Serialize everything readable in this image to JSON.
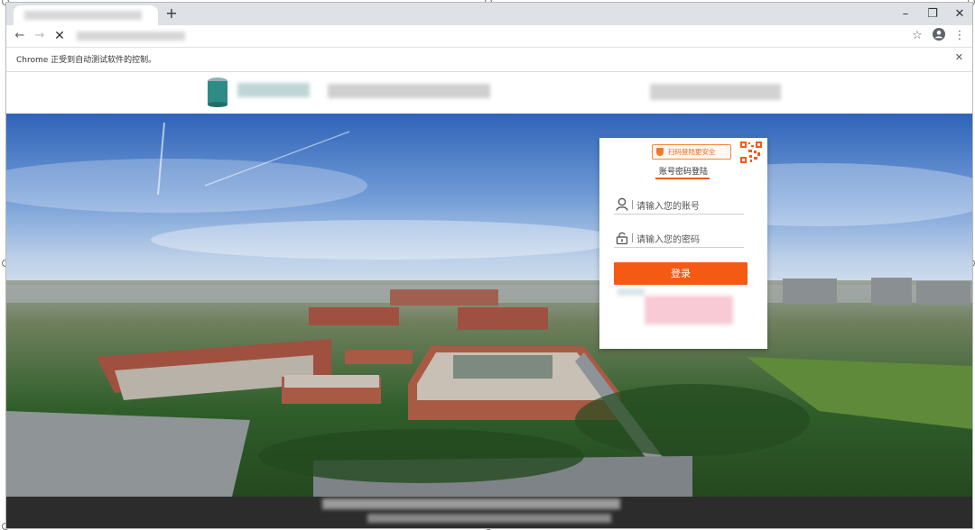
{
  "browser": {
    "tab_title": "",
    "new_tab_symbol": "+",
    "window_controls": {
      "minimize": "–",
      "restore": "❐",
      "close": "✕"
    },
    "nav": {
      "back": "←",
      "forward": "→",
      "stop": "✕"
    },
    "toolbar_icons": [
      "star-icon",
      "profile-icon",
      "menu-icon"
    ],
    "menu_symbol": "⋮",
    "star_symbol": "☆",
    "automation_notice": "Chrome 正受到自动测试软件的控制。",
    "notice_close": "✕"
  },
  "login": {
    "scan_badge": "扫码登陆更安全",
    "tab_label": "账号密码登陆",
    "account_placeholder": "请输入您的账号",
    "password_placeholder": "请输入您的密码",
    "submit_label": "登录"
  },
  "colors": {
    "accent": "#f55a14",
    "badge_border": "#f08a3a",
    "footer": "#2c2c2c"
  }
}
